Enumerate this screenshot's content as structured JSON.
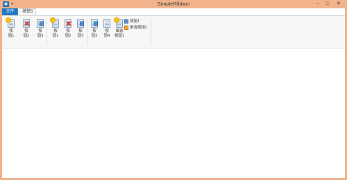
{
  "window": {
    "title": "SimpleRibbon"
  },
  "titlebar": {
    "qat_arrow": "▾",
    "minimize": "–",
    "maximize": "□",
    "close": "✕"
  },
  "tabs": {
    "file": "文件",
    "tab1": "按钮1"
  },
  "ribbon": {
    "group1": {
      "buttons": [
        {
          "label": "按\n钮1",
          "icon": "new-doc-icon"
        },
        {
          "label": "按\n钮2",
          "icon": "delete-doc-icon"
        },
        {
          "label": "按\n钮3",
          "icon": "edit-doc-icon"
        }
      ]
    },
    "group2": {
      "buttons": [
        {
          "label": "按\n钮1",
          "icon": "new-doc-icon"
        },
        {
          "label": "按\n钮2",
          "icon": "delete-doc-icon"
        },
        {
          "label": "按\n钮3",
          "icon": "edit-doc-icon"
        }
      ]
    },
    "group3": {
      "buttons": [
        {
          "label": "按\n钮3",
          "icon": "edit-doc-icon"
        },
        {
          "label": "按\n钮4",
          "icon": "doc-icon"
        },
        {
          "label": "单选\n按钮1",
          "icon": "new-doc-icon"
        }
      ],
      "small_buttons": [
        {
          "label": "按钮1",
          "icon": "user-icon"
        },
        {
          "label": "单选按钮2",
          "icon": "edit-icon"
        }
      ]
    }
  }
}
